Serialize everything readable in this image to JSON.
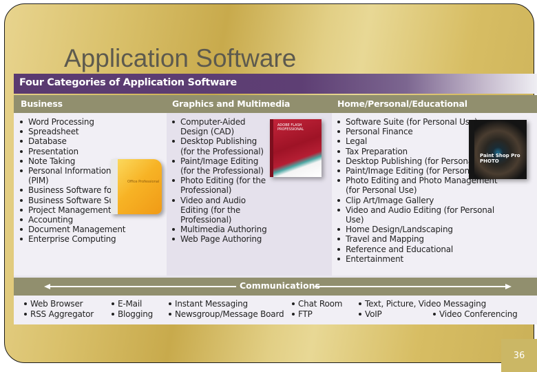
{
  "slide": {
    "title": "Application Software",
    "page_number": "36"
  },
  "figure": {
    "title": "Four Categories of Application Software",
    "categories": [
      {
        "label": "Business",
        "items": [
          "Word Processing",
          "Spreadsheet",
          "Database",
          "Presentation",
          "Note Taking",
          "Personal Information Manager (PIM)",
          "Business Software for Phones",
          "Business Software Suite",
          "Project Management",
          "Accounting",
          "Document Management",
          "Enterprise Computing"
        ],
        "product_image": "Microsoft Office Professional box",
        "product_text": "Office Professional"
      },
      {
        "label": "Graphics and Multimedia",
        "items": [
          "Computer-Aided Design (CAD)",
          "Desktop Publishing (for the Professional)",
          "Paint/Image Editing (for the Professional)",
          "Photo Editing (for the Professional)",
          "Video and Audio Editing (for the Professional)",
          "Multimedia Authoring",
          "Web Page Authoring"
        ],
        "product_image": "Adobe Flash Professional box",
        "product_text": "ADOBE FLASH PROFESSIONAL"
      },
      {
        "label": "Home/Personal/Educational",
        "items": [
          "Software Suite (for Personal Use)",
          "Personal Finance",
          "Legal",
          "Tax Preparation",
          "Desktop Publishing (for Personal Use)",
          "Paint/Image Editing (for Personal Use)",
          "Photo Editing and Photo Management (for Personal Use)",
          "Clip Art/Image Gallery",
          "Video and Audio Editing (for Personal Use)",
          "Home Design/Landscaping",
          "Travel and Mapping",
          "Reference and Educational",
          "Entertainment"
        ],
        "product_image": "Corel Paint Shop Pro Photo box",
        "product_text": "Paint Shop Pro PHOTO"
      }
    ],
    "communications": {
      "label": "Communications",
      "items": [
        "Web Browser",
        "RSS Aggregator",
        "E-Mail",
        "Blogging",
        "Instant Messaging",
        "Newsgroup/Message Board",
        "Chat Room",
        "FTP",
        "Text, Picture, Video Messaging",
        "VoIP",
        "Video Conferencing"
      ]
    }
  },
  "colors": {
    "header_purple": "#5a3a70",
    "category_bar": "#918f6e",
    "background_gold": "#d7bd63"
  }
}
